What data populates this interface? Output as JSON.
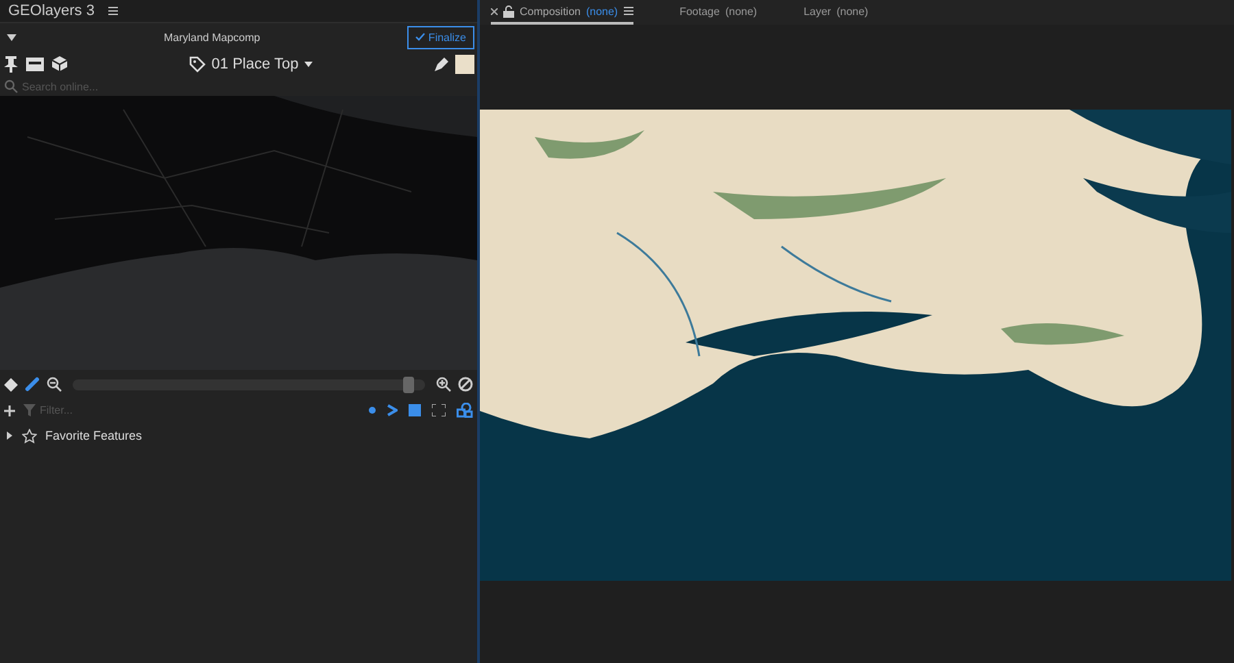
{
  "panel": {
    "title": "GEOlayers 3",
    "comp_name": "Maryland Mapcomp",
    "finalize_label": "Finalize",
    "style_name": "01 Place Top",
    "search": {
      "placeholder": "Search online..."
    },
    "zoom": {
      "level": 0.97
    },
    "filter": {
      "placeholder": "Filter..."
    },
    "features": [
      {
        "label": "Favorite Features",
        "expanded": false
      }
    ]
  },
  "viewer_tabs": [
    {
      "label": "Composition",
      "value": "(none)",
      "selected": true,
      "closable": true
    },
    {
      "label": "Footage",
      "value": "(none)",
      "selected": false,
      "closable": false
    },
    {
      "label": "Layer",
      "value": "(none)",
      "selected": false,
      "closable": false
    }
  ]
}
